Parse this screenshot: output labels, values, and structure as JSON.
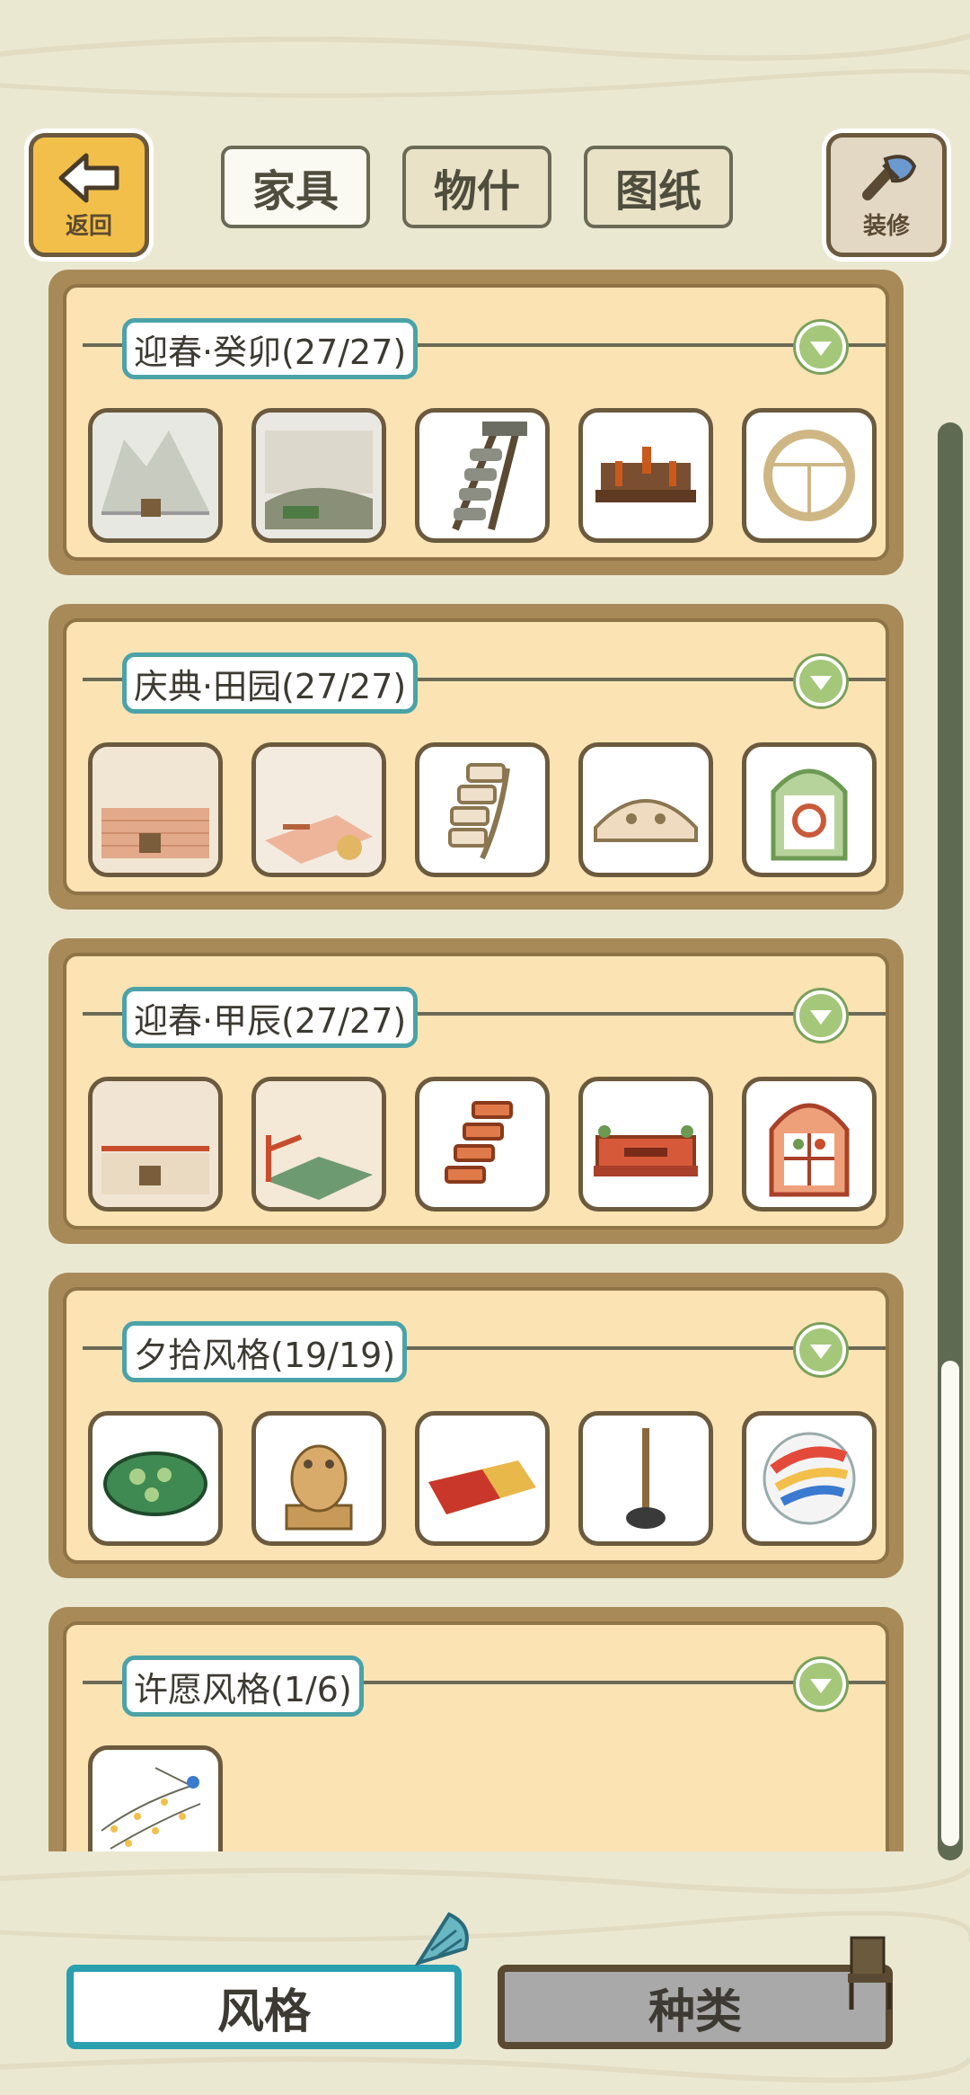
{
  "header": {
    "back_label": "返回",
    "decorate_label": "装修",
    "tabs": [
      {
        "label": "家具",
        "active": true
      },
      {
        "label": "物什",
        "active": false
      },
      {
        "label": "图纸",
        "active": false
      }
    ]
  },
  "sections": [
    {
      "title": "迎春·癸卯(27/27)",
      "items": [
        "wall-scene-icon",
        "floor-scene-icon",
        "ladder-icon",
        "wood-bench-icon",
        "round-window-icon"
      ]
    },
    {
      "title": "庆典·田园(27/27)",
      "items": [
        "brick-wall-scene-icon",
        "patterned-floor-scene-icon",
        "curved-stairs-icon",
        "cream-bench-icon",
        "green-window-icon"
      ]
    },
    {
      "title": "迎春·甲辰(27/27)",
      "items": [
        "red-wall-scene-icon",
        "tiled-floor-scene-icon",
        "red-stairs-icon",
        "red-bench-icon",
        "arched-window-icon"
      ]
    },
    {
      "title": "夕拾风格(19/19)",
      "items": [
        "green-frog-stone-icon",
        "frog-statue-icon",
        "rug-icon",
        "pole-lamp-icon",
        "colorful-ball-icon"
      ]
    },
    {
      "title": "许愿风格(1/6)",
      "items": [
        "star-garland-icon"
      ]
    }
  ],
  "bottom": {
    "style_label": "风格",
    "kind_label": "种类"
  },
  "colors": {
    "accent_teal": "#2a9fb0",
    "panel_bg": "#fbe3b3",
    "toggle_green": "#a5c77a"
  }
}
